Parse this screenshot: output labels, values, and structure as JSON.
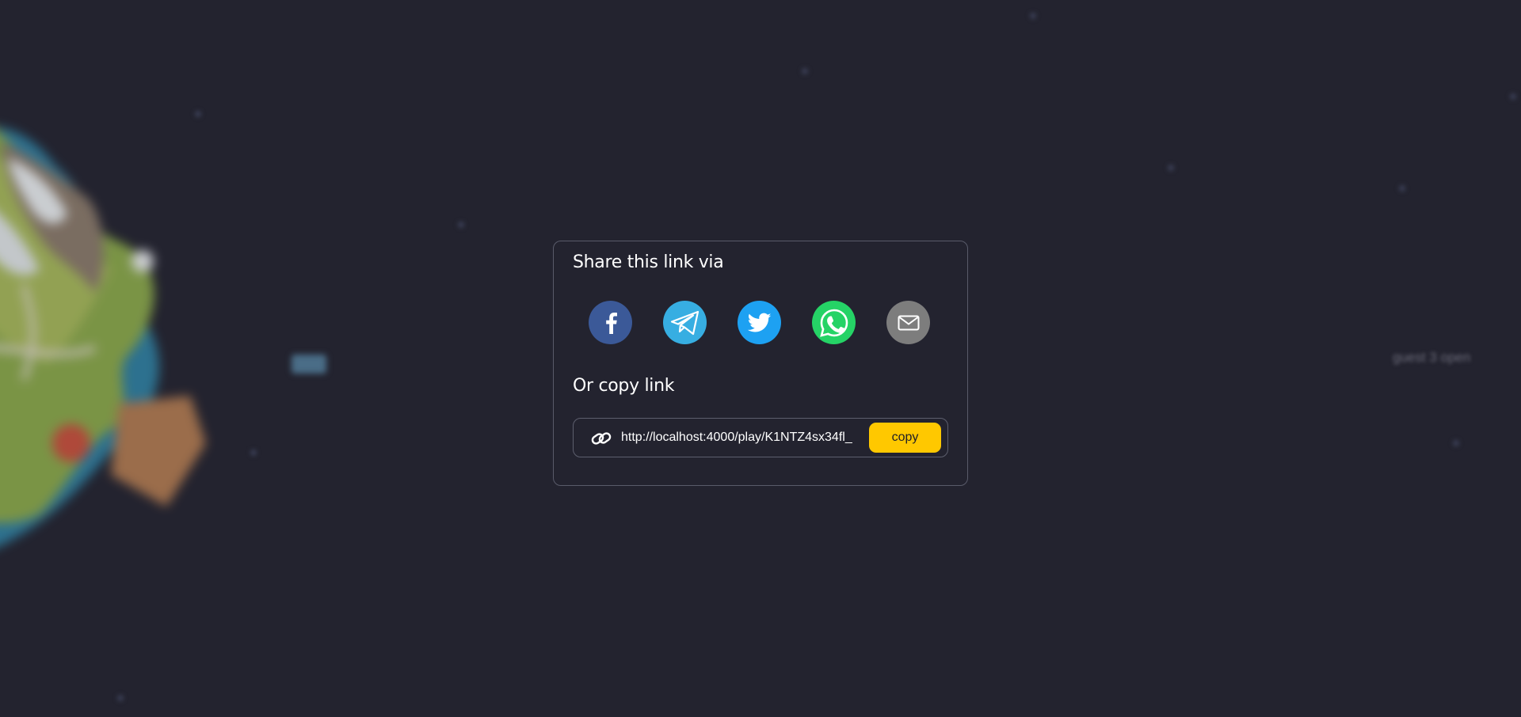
{
  "dialog": {
    "title": "Share this link via",
    "copy_title": "Or copy link",
    "share_options": [
      {
        "name": "facebook",
        "icon": "facebook-icon",
        "color": "#3b5998"
      },
      {
        "name": "telegram",
        "icon": "telegram-icon",
        "color": "#37aee2"
      },
      {
        "name": "twitter",
        "icon": "twitter-icon",
        "color": "#1da1f2"
      },
      {
        "name": "whatsapp",
        "icon": "whatsapp-icon",
        "color": "#25d366"
      },
      {
        "name": "email",
        "icon": "mail-icon",
        "color": "#7d7d7d"
      }
    ],
    "link": {
      "icon": "link-icon",
      "value": "http://localhost:4000/play/K1NTZ4sx34fl_",
      "copy_label": "copy",
      "copy_color": "#ffc800"
    }
  },
  "background": {
    "caption": "guest 3 open"
  },
  "theme": {
    "background": "#23232f",
    "dialog_border": "#595b6a"
  }
}
